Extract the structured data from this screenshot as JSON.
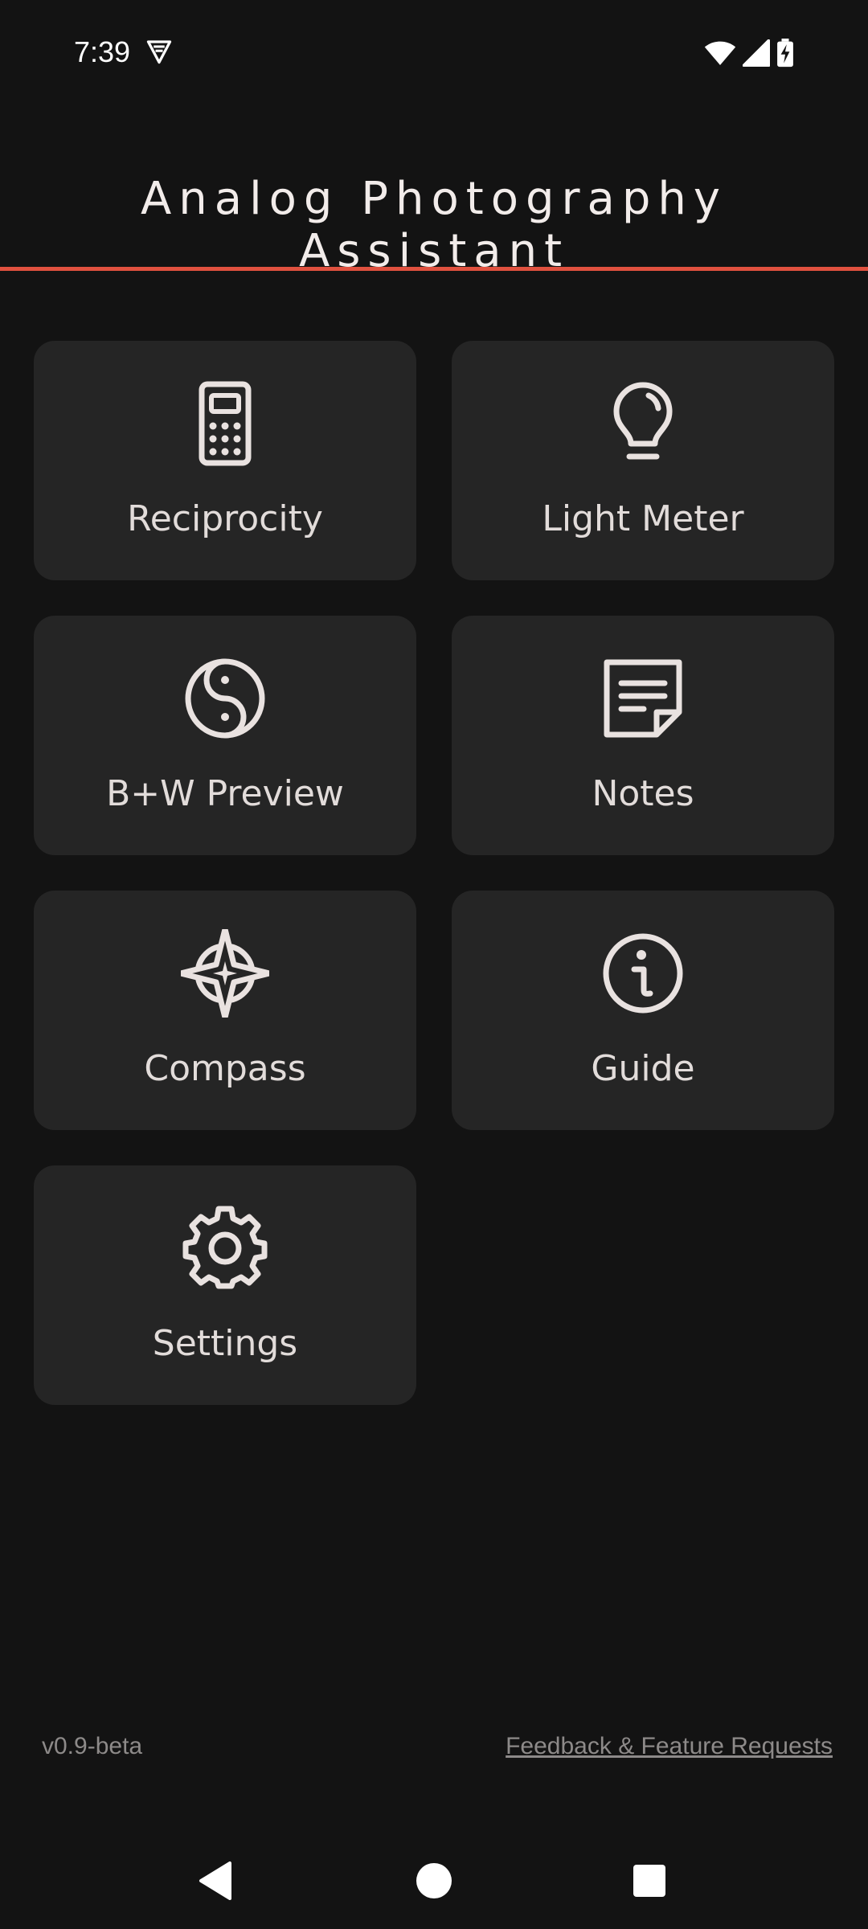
{
  "status_bar": {
    "time": "7:39",
    "icons": [
      "vpn-shield-icon",
      "wifi-icon",
      "cell-signal-icon",
      "battery-charging-icon"
    ]
  },
  "header": {
    "title": "Analog Photography Assistant",
    "accent_color": "#e0513f"
  },
  "tiles": [
    {
      "label": "Reciprocity",
      "icon": "calculator-icon"
    },
    {
      "label": "Light Meter",
      "icon": "lightbulb-icon"
    },
    {
      "label": "B+W Preview",
      "icon": "yin-yang-icon"
    },
    {
      "label": "Notes",
      "icon": "note-icon"
    },
    {
      "label": "Compass",
      "icon": "compass-icon"
    },
    {
      "label": "Guide",
      "icon": "info-icon"
    },
    {
      "label": "Settings",
      "icon": "gear-icon"
    }
  ],
  "footer": {
    "version": "v0.9-beta",
    "feedback_link": "Feedback & Feature Requests"
  },
  "nav_bar": {
    "buttons": [
      "back-icon",
      "home-icon",
      "recents-icon"
    ]
  },
  "colors": {
    "background": "#131313",
    "tile_background": "#252525",
    "icon_stroke": "#e9e2e0",
    "muted_text": "#8d8a89"
  }
}
